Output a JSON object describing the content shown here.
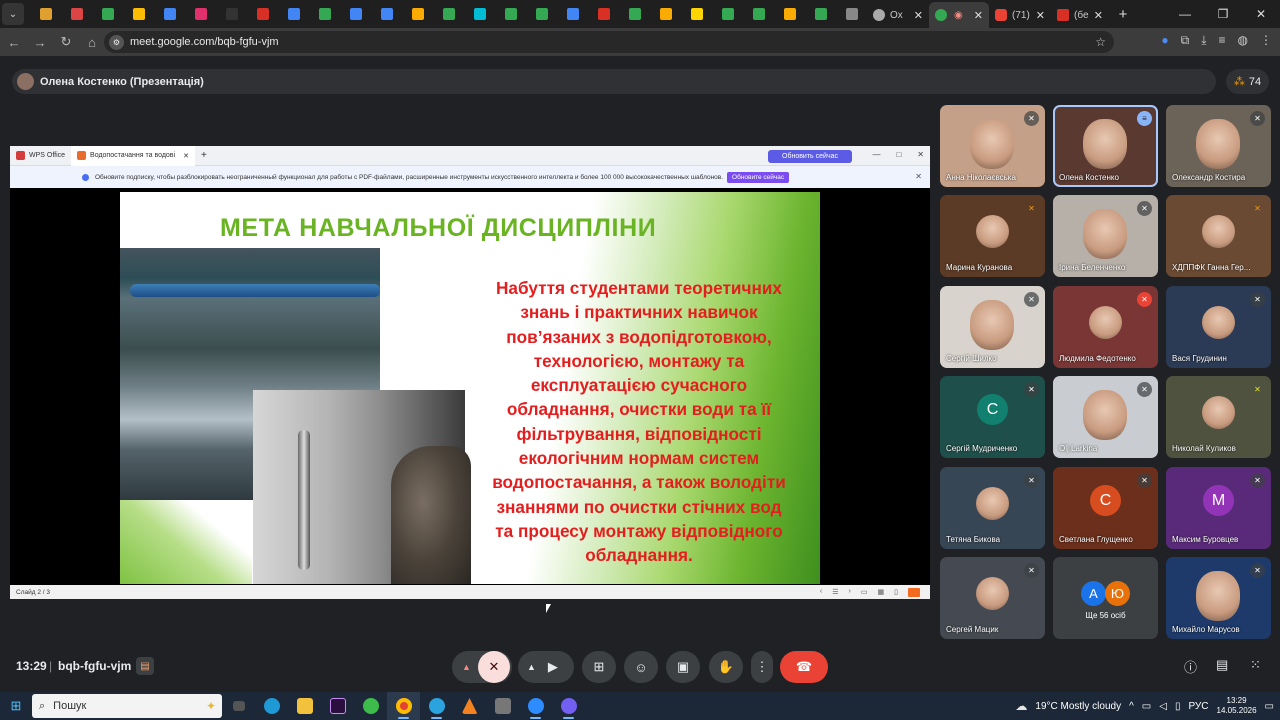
{
  "browser": {
    "tabs": [
      {
        "label": "Ox"
      },
      {
        "label": ""
      },
      {
        "label": "(71)"
      },
      {
        "label": "(бе"
      }
    ],
    "url": "meet.google.com/bqb-fgfu-vjm"
  },
  "meet": {
    "presenter_title": "Олена Костенко (Презентація)",
    "participant_count": "74",
    "meeting_time": "13:29",
    "meeting_code": "bqb-fgfu-vjm"
  },
  "presentation": {
    "wps_tab": "WPS Office",
    "doc_tab": "Водопостачання та водові",
    "update_button": "Обновить сейчас",
    "notice_text": "Обновите подписку, чтобы разблокировать неограниченный функционал для работы с PDF-файлами, расширенные инструменты искусственного интеллекта и более 100 000 высококачественных шаблонов.",
    "notice_button": "Обновите сейчас",
    "slide_title": "МЕТА НАВЧАЛЬНОЇ ДИСЦИПЛІНИ",
    "slide_lines": [
      "Набуття студентами теоретичних",
      "знань і практичних навичок",
      "пов’язаних з водопідготовкою,",
      "технологією, монтажу та",
      "експлуатацією сучасного",
      "обладнання, очистки води та її",
      "фільтрування, відповідності",
      "екологічним нормам систем",
      "водопостачання, а також володіти",
      "знаннями по очистки стічних вод",
      "та процесу монтажу відповідного",
      "обладнання."
    ],
    "slide_counter": "Слайд 2 / 3"
  },
  "participants": [
    {
      "name": "Анна Ніколаєвська",
      "mic": "muted",
      "kind": "video",
      "bg": "#c4a089"
    },
    {
      "name": "Олена Костенко",
      "mic": "speaking",
      "kind": "video",
      "bg": "#5a3a30"
    },
    {
      "name": "Олександр Костира",
      "mic": "muted",
      "kind": "video",
      "bg": "#6b6258"
    },
    {
      "name": "Марина Куранова",
      "mic": "orange",
      "kind": "photo",
      "bg": "#5c3b26"
    },
    {
      "name": "Ірина Беленченко",
      "mic": "muted",
      "kind": "video",
      "bg": "#b7b0a8"
    },
    {
      "name": "ХДППФК Ганна Гер...",
      "mic": "orange",
      "kind": "photo",
      "bg": "#6a4a33"
    },
    {
      "name": "Сергій Шилко",
      "mic": "muted",
      "kind": "video",
      "bg": "#d8d3cc"
    },
    {
      "name": "Людмила Федотенко",
      "mic": "red",
      "kind": "photo",
      "bg": "#7a3535"
    },
    {
      "name": "Вася Грудинин",
      "mic": "muted",
      "kind": "photo",
      "bg": "#2b3a55"
    },
    {
      "name": "Сергій Мудриченко",
      "mic": "muted",
      "kind": "letter",
      "letter": "С",
      "bg": "#1f4f4a",
      "circle": "#12806f"
    },
    {
      "name": "Olj Larkina",
      "mic": "muted",
      "kind": "video",
      "bg": "#c9ccd0"
    },
    {
      "name": "Николай Куликов",
      "mic": "yellow",
      "kind": "photo",
      "bg": "#4f523e"
    },
    {
      "name": "Тетяна Бикова",
      "mic": "muted",
      "kind": "photo",
      "bg": "#374655"
    },
    {
      "name": "Светлана Глущенко",
      "mic": "muted",
      "kind": "letter",
      "letter": "С",
      "bg": "#6b2f1c",
      "circle": "#d84d1f"
    },
    {
      "name": "Максим Буровцев",
      "mic": "muted",
      "kind": "letter",
      "letter": "М",
      "bg": "#5a2a7a",
      "circle": "#9334b8"
    },
    {
      "name": "Сергей Мацик",
      "mic": "muted",
      "kind": "photo",
      "bg": "#454a52"
    },
    {
      "name": "Михайло Марусов",
      "mic": "muted",
      "kind": "video",
      "bg": "#1d3a6b"
    }
  ],
  "others": {
    "avatar1": "А",
    "avatar2": "Ю",
    "label": "Ще 56 осіб"
  },
  "taskbar": {
    "search_placeholder": "Пошук",
    "weather": "19°C  Mostly cloudy",
    "lang": "РУС",
    "clock_time": "13:29",
    "clock_date": "14.05.2026"
  },
  "colors": {
    "slide_title": "#6ab424",
    "slide_text": "#e41e1e",
    "hangup": "#ea4335",
    "meet_bg": "#202124"
  }
}
